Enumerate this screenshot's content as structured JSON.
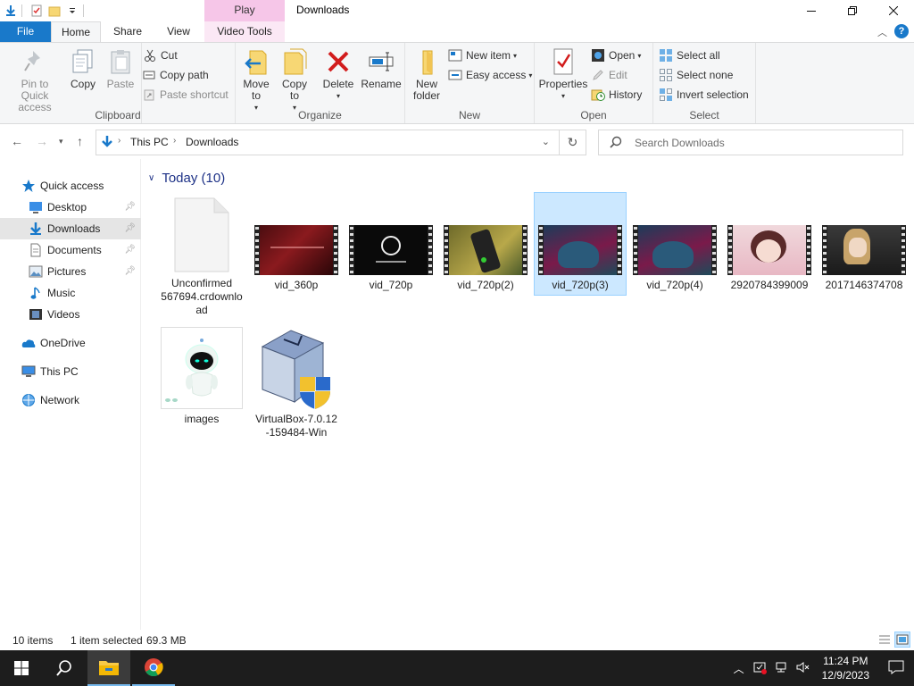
{
  "window": {
    "title": "Downloads",
    "context_tab_header": "Play"
  },
  "tabs": {
    "file": "File",
    "home": "Home",
    "share": "Share",
    "view": "View",
    "video_tools": "Video Tools"
  },
  "ribbon": {
    "clipboard": {
      "label": "Clipboard",
      "pin": "Pin to Quick access",
      "copy": "Copy",
      "paste": "Paste",
      "cut": "Cut",
      "copy_path": "Copy path",
      "paste_shortcut": "Paste shortcut"
    },
    "organize": {
      "label": "Organize",
      "move_to": "Move to",
      "copy_to": "Copy to",
      "delete": "Delete",
      "rename": "Rename"
    },
    "new": {
      "label": "New",
      "new_folder": "New folder",
      "new_item": "New item",
      "easy_access": "Easy access"
    },
    "open": {
      "label": "Open",
      "properties": "Properties",
      "open": "Open",
      "edit": "Edit",
      "history": "History"
    },
    "select": {
      "label": "Select",
      "select_all": "Select all",
      "select_none": "Select none",
      "invert": "Invert selection"
    }
  },
  "address": {
    "path": [
      "This PC",
      "Downloads"
    ],
    "search_placeholder": "Search Downloads"
  },
  "nav": {
    "items": [
      {
        "label": "Quick access"
      },
      {
        "label": "Desktop"
      },
      {
        "label": "Downloads"
      },
      {
        "label": "Documents"
      },
      {
        "label": "Pictures"
      },
      {
        "label": "Music"
      },
      {
        "label": "Videos"
      },
      {
        "label": "OneDrive"
      },
      {
        "label": "This PC"
      },
      {
        "label": "Network"
      }
    ]
  },
  "content": {
    "group_header": "Today (10)",
    "files": [
      {
        "name": "Unconfirmed 567694.crdownload",
        "type": "document"
      },
      {
        "name": "vid_360p",
        "type": "video"
      },
      {
        "name": "vid_720p",
        "type": "video"
      },
      {
        "name": "vid_720p(2)",
        "type": "video"
      },
      {
        "name": "vid_720p(3)",
        "type": "video",
        "selected": true
      },
      {
        "name": "vid_720p(4)",
        "type": "video"
      },
      {
        "name": "2920784399009",
        "type": "video"
      },
      {
        "name": "2017146374708",
        "type": "video"
      },
      {
        "name": "images",
        "type": "image"
      },
      {
        "name": "VirtualBox-7.0.12-159484-Win",
        "type": "installer"
      }
    ],
    "file0_lines": [
      "Unconfirmed",
      "567694.crdownlo",
      "ad"
    ],
    "file9_lines": [
      "VirtualBox-7.0.12",
      "-159484-Win"
    ]
  },
  "status": {
    "count": "10 items",
    "selection": "1 item selected",
    "size": "69.3 MB"
  },
  "taskbar": {
    "time": "11:24 PM",
    "date": "12/9/2023"
  },
  "colors": {
    "accent": "#1979ca",
    "selection_bg": "#cce8ff",
    "group_header": "#1e3287",
    "taskbar": "#1d1d1d"
  }
}
